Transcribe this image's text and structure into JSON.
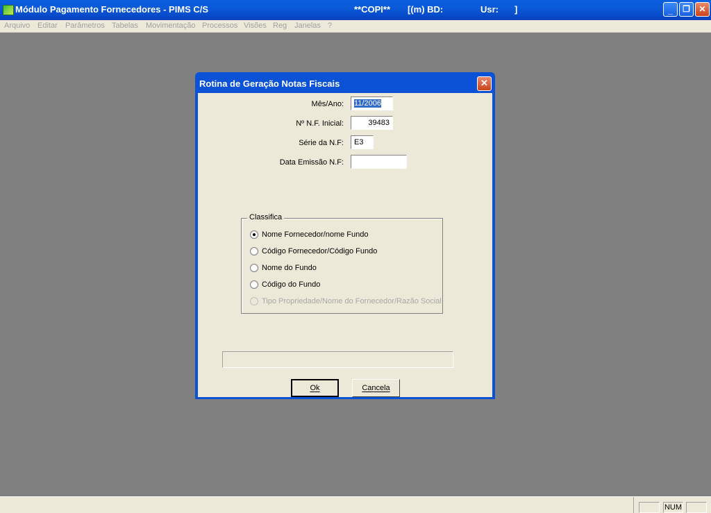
{
  "window": {
    "title": "Módulo Pagamento Fornecedores - PIMS C/S",
    "company": "**COPI**",
    "db": "[(m) BD:",
    "user": "Usr:",
    "bracket": "]"
  },
  "menu": [
    "Arquivo",
    "Editar",
    "Parâmetros",
    "Tabelas",
    "Movimentação",
    "Processos",
    "Visões",
    "Reg",
    "Janelas",
    "?"
  ],
  "dialog": {
    "title": "Rotina de Geração Notas Fiscais",
    "fields": {
      "mes_ano": {
        "label": "Mês/Ano:",
        "value": "11/2006"
      },
      "nf_inicial": {
        "label": "Nº N.F. Inicial:",
        "value": "39483"
      },
      "serie": {
        "label": "Série da N.F:",
        "value": "E3"
      },
      "data_emissao": {
        "label": "Data Emissão N.F:",
        "value": ""
      }
    },
    "classifica": {
      "legend": "Classifica",
      "options": [
        {
          "label": "Nome Fornecedor/nome Fundo",
          "checked": true,
          "disabled": false
        },
        {
          "label": "Código Fornecedor/Código Fundo",
          "checked": false,
          "disabled": false
        },
        {
          "label": "Nome do Fundo",
          "checked": false,
          "disabled": false
        },
        {
          "label": "Código do Fundo",
          "checked": false,
          "disabled": false
        },
        {
          "label": "Tipo Propriedade/Nome do Fornecedor/Razão Social",
          "checked": false,
          "disabled": true
        }
      ]
    },
    "buttons": {
      "ok": "Ok",
      "cancel": "Cancela"
    }
  },
  "statusbar": {
    "num": "NUM"
  }
}
